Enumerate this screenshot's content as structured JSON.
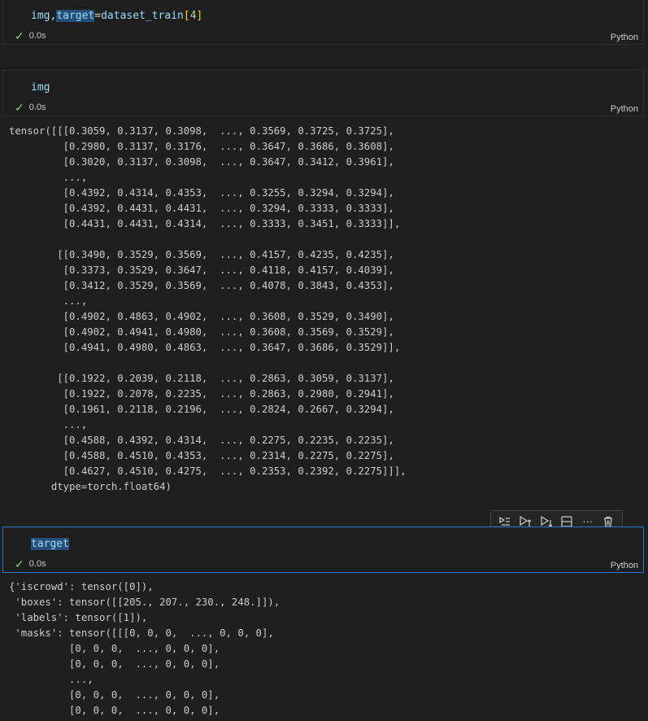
{
  "cells": [
    {
      "code_parts": {
        "a": "img",
        "b": ",",
        "c": "target",
        "d": "=",
        "e": "dataset_train",
        "f": "[",
        "g": "4",
        "h": "]"
      },
      "time": "0.0s",
      "language": "Python"
    },
    {
      "code": "img",
      "time": "0.0s",
      "language": "Python"
    },
    {
      "code": "target",
      "time": "0.0s",
      "language": "Python"
    }
  ],
  "outputs": {
    "img": "tensor([[[0.3059, 0.3137, 0.3098,  ..., 0.3569, 0.3725, 0.3725],\n         [0.2980, 0.3137, 0.3176,  ..., 0.3647, 0.3686, 0.3608],\n         [0.3020, 0.3137, 0.3098,  ..., 0.3647, 0.3412, 0.3961],\n         ...,\n         [0.4392, 0.4314, 0.4353,  ..., 0.3255, 0.3294, 0.3294],\n         [0.4392, 0.4431, 0.4431,  ..., 0.3294, 0.3333, 0.3333],\n         [0.4431, 0.4431, 0.4314,  ..., 0.3333, 0.3451, 0.3333]],\n\n        [[0.3490, 0.3529, 0.3569,  ..., 0.4157, 0.4235, 0.4235],\n         [0.3373, 0.3529, 0.3647,  ..., 0.4118, 0.4157, 0.4039],\n         [0.3412, 0.3529, 0.3569,  ..., 0.4078, 0.3843, 0.4353],\n         ...,\n         [0.4902, 0.4863, 0.4902,  ..., 0.3608, 0.3529, 0.3490],\n         [0.4902, 0.4941, 0.4980,  ..., 0.3608, 0.3569, 0.3529],\n         [0.4941, 0.4980, 0.4863,  ..., 0.3647, 0.3686, 0.3529]],\n\n        [[0.1922, 0.2039, 0.2118,  ..., 0.2863, 0.3059, 0.3137],\n         [0.1922, 0.2078, 0.2235,  ..., 0.2863, 0.2980, 0.2941],\n         [0.1961, 0.2118, 0.2196,  ..., 0.2824, 0.2667, 0.3294],\n         ...,\n         [0.4588, 0.4392, 0.4314,  ..., 0.2275, 0.2235, 0.2235],\n         [0.4588, 0.4510, 0.4353,  ..., 0.2314, 0.2275, 0.2275],\n         [0.4627, 0.4510, 0.4275,  ..., 0.2353, 0.2392, 0.2275]]],\n       dtype=torch.float64)",
    "target": "{'iscrowd': tensor([0]),\n 'boxes': tensor([[205., 207., 230., 248.]]),\n 'labels': tensor([1]),\n 'masks': tensor([[[0, 0, 0,  ..., 0, 0, 0],\n          [0, 0, 0,  ..., 0, 0, 0],\n          [0, 0, 0,  ..., 0, 0, 0],\n          ...,\n          [0, 0, 0,  ..., 0, 0, 0],\n          [0, 0, 0,  ..., 0, 0, 0],"
  },
  "toolbar": {
    "icons": [
      "run-by-line-icon",
      "execute-above-icon",
      "execute-below-icon",
      "split-cell-icon",
      "more-actions-icon",
      "delete-cell-icon"
    ],
    "more_glyph": "···"
  }
}
